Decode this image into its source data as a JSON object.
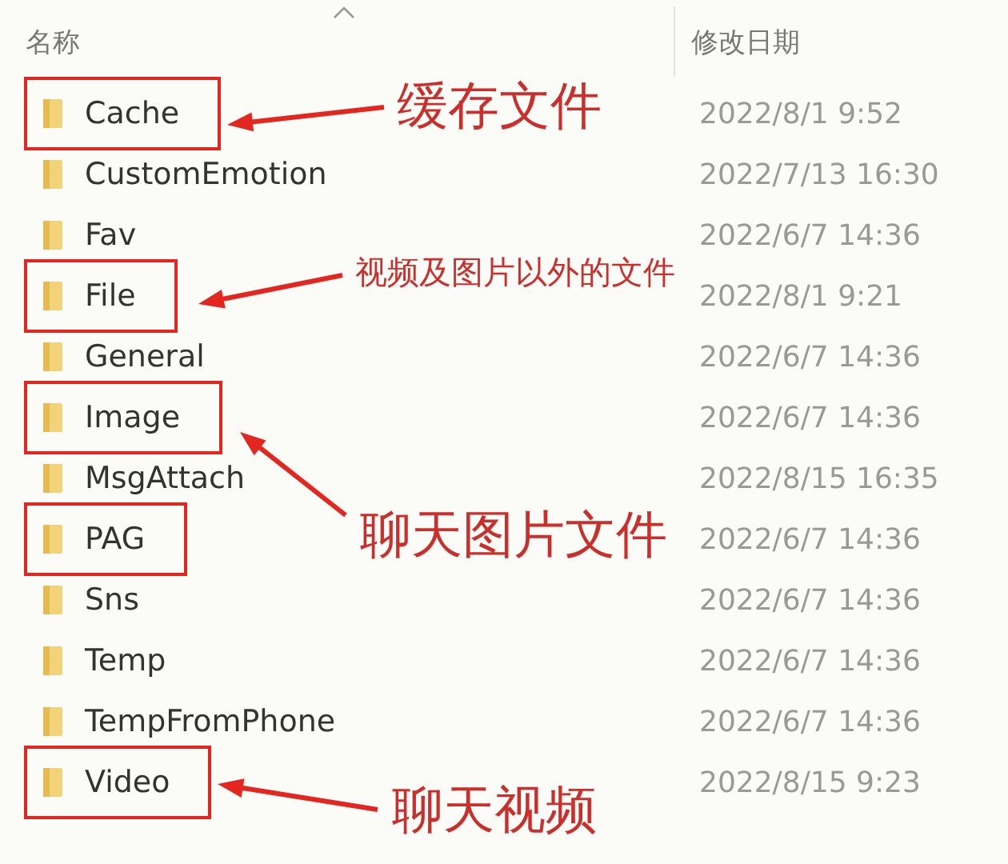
{
  "columns": [
    "名称",
    "修改日期"
  ],
  "rows": [
    {
      "name": "Cache",
      "modified": "2022/8/1 9:52",
      "highlighted": true
    },
    {
      "name": "CustomEmotion",
      "modified": "2022/7/13 16:30",
      "highlighted": false
    },
    {
      "name": "Fav",
      "modified": "2022/6/7 14:36",
      "highlighted": false
    },
    {
      "name": "File",
      "modified": "2022/8/1 9:21",
      "highlighted": true
    },
    {
      "name": "General",
      "modified": "2022/6/7 14:36",
      "highlighted": false
    },
    {
      "name": "Image",
      "modified": "2022/6/7 14:36",
      "highlighted": true
    },
    {
      "name": "MsgAttach",
      "modified": "2022/8/15 16:35",
      "highlighted": false
    },
    {
      "name": "PAG",
      "modified": "2022/6/7 14:36",
      "highlighted": true
    },
    {
      "name": "Sns",
      "modified": "2022/6/7 14:36",
      "highlighted": false
    },
    {
      "name": "Temp",
      "modified": "2022/6/7 14:36",
      "highlighted": false
    },
    {
      "name": "TempFromPhone",
      "modified": "2022/6/7 14:36",
      "highlighted": false
    },
    {
      "name": "Video",
      "modified": "2022/8/15 9:23",
      "highlighted": true
    }
  ],
  "annotations": [
    "缓存文件",
    "视频及图片以外的文件",
    "聊天图片文件",
    "聊天视频"
  ]
}
